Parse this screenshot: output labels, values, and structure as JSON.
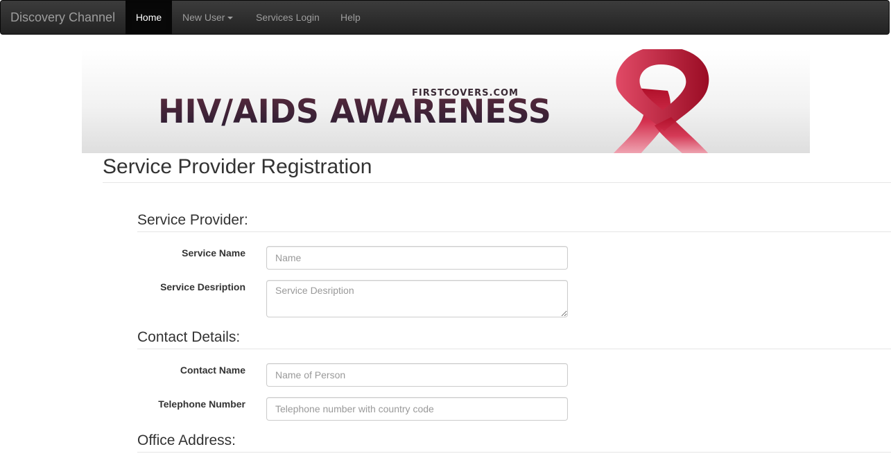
{
  "navbar": {
    "brand": "Discovery Channel",
    "items": [
      {
        "label": "Home",
        "active": true
      },
      {
        "label": "New User",
        "dropdown": true
      },
      {
        "label": "Services Login"
      },
      {
        "label": "Help"
      }
    ]
  },
  "banner": {
    "small_text": "FIRSTCOVERS.COM",
    "big_text": "HIV/AIDS AWARENESS",
    "ribbon_color": "#c8102e"
  },
  "page": {
    "title": "Service Provider Registration"
  },
  "sections": {
    "service_provider": {
      "title": "Service Provider:",
      "service_name": {
        "label": "Service Name",
        "placeholder": "Name"
      },
      "service_description": {
        "label": "Service Desription",
        "placeholder": "Service Desription"
      }
    },
    "contact_details": {
      "title": "Contact Details:",
      "contact_name": {
        "label": "Contact Name",
        "placeholder": "Name of Person"
      },
      "telephone": {
        "label": "Telephone Number",
        "placeholder": "Telephone number with country code"
      }
    },
    "office_address": {
      "title": "Office Address:"
    }
  }
}
